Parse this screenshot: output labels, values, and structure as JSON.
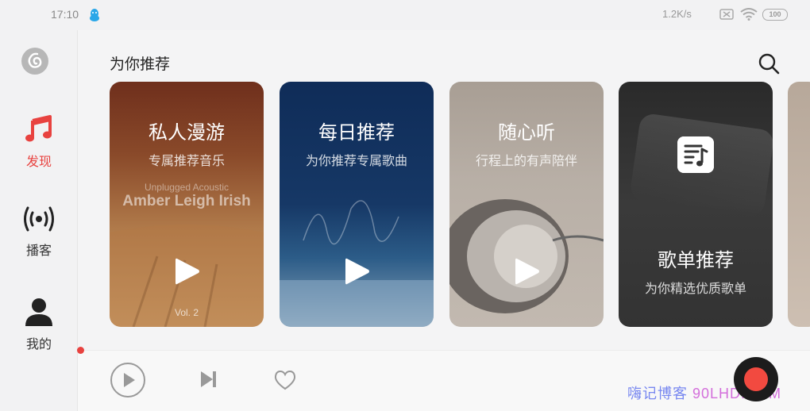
{
  "status_bar": {
    "time": "17:10",
    "net_speed": "1.2K/s",
    "battery": "100",
    "icons": [
      "qq-icon",
      "no-sim-icon",
      "wifi-icon",
      "battery-icon"
    ]
  },
  "sidebar": {
    "items": [
      {
        "label": "发现",
        "icon": "music-note-icon",
        "active": true
      },
      {
        "label": "播客",
        "icon": "broadcast-icon",
        "active": false
      },
      {
        "label": "我的",
        "icon": "user-icon",
        "active": false
      }
    ]
  },
  "header": {
    "title": "为你推荐"
  },
  "cards": [
    {
      "title": "私人漫游",
      "subtitle": "专属推荐音乐",
      "art_small": "Unplugged Acoustic",
      "art_big": "Amber Leigh Irish",
      "art_vol": "Vol. 2"
    },
    {
      "title": "每日推荐",
      "subtitle": "为你推荐专属歌曲"
    },
    {
      "title": "随心听",
      "subtitle": "行程上的有声陪伴"
    },
    {
      "title": "歌单推荐",
      "subtitle": "为你精选优质歌单"
    }
  ],
  "watermark": {
    "part1": "嗨记博客",
    "part2": "90LHD.COM"
  },
  "colors": {
    "accent": "#e8423f",
    "sidebar_bg": "#f2f2f3",
    "text": "#222222"
  }
}
